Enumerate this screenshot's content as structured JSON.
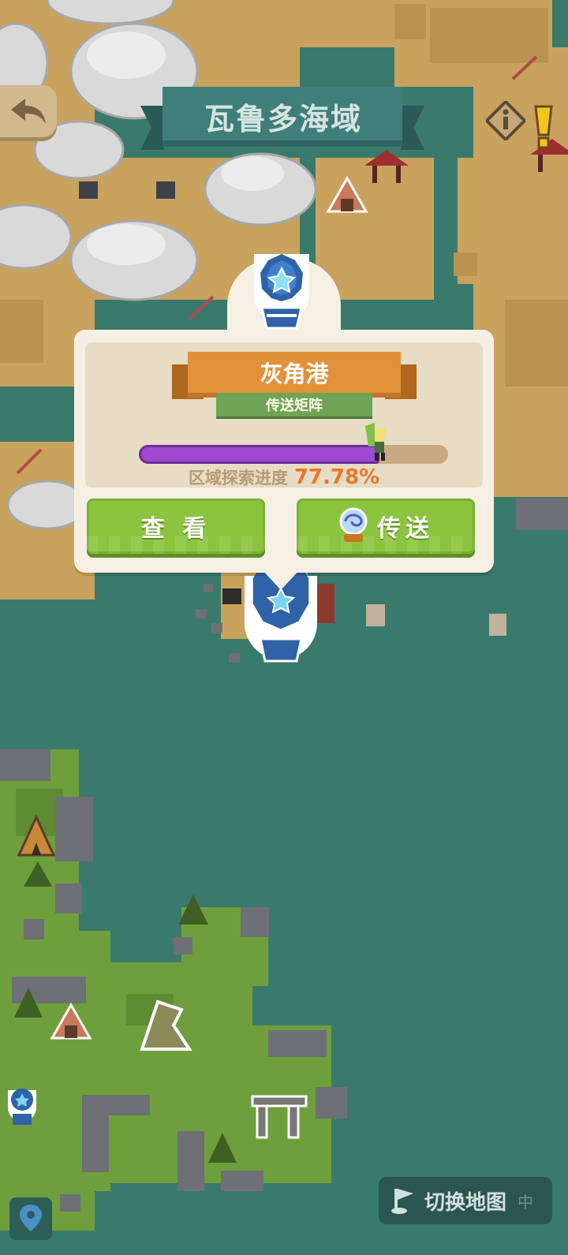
{
  "header": {
    "title": "瓦鲁多海域"
  },
  "popup": {
    "location_name": "灰角港",
    "location_type": "传送矩阵",
    "progress_caption": "区域探索进度",
    "progress_value": "77.78%",
    "progress_fraction": 0.7778,
    "view_button": "查 看",
    "teleport_button": "传送"
  },
  "footer": {
    "switch_map_label": "切换地图",
    "switch_map_key": "中"
  },
  "icons": {
    "back": "back-arrow-icon",
    "info": "info-icon",
    "alert": "exclamation-icon",
    "location": "location-pin-icon",
    "flag": "flag-icon",
    "portal": "portal-orb-icon",
    "waypoint": "star-waypoint-icon"
  },
  "colors": {
    "sea": "#3a7a6c",
    "sand": "#c9a35e",
    "grass": "#6e9f3c",
    "button_green": "#8cc43f",
    "banner_orange": "#e0913a",
    "progress_purple": "#9d4ad0",
    "progress_text": "#e8772e"
  }
}
